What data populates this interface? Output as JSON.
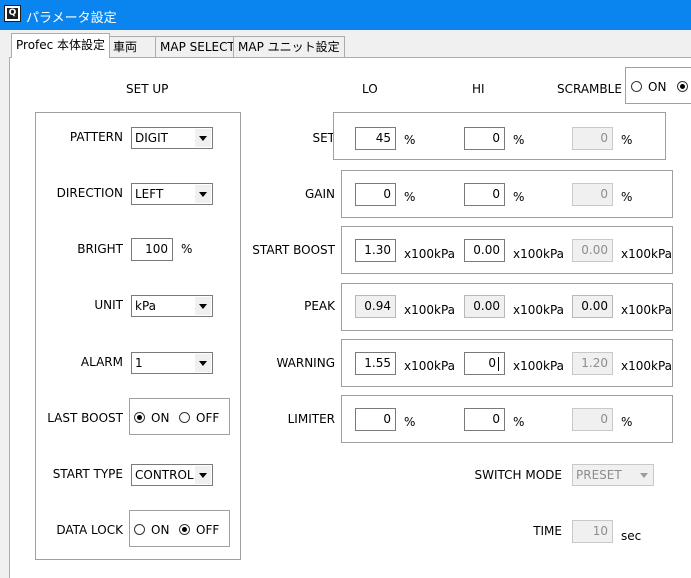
{
  "window": {
    "title": "パラメータ設定",
    "icon_text": "Q"
  },
  "tabs": [
    "Profec 本体設定",
    "車両",
    "MAP SELECT",
    "MAP ユニット設定"
  ],
  "setup": {
    "header": "SET UP",
    "pattern": {
      "label": "PATTERN",
      "value": "DIGIT"
    },
    "direction": {
      "label": "DIRECTION",
      "value": "LEFT"
    },
    "bright": {
      "label": "BRIGHT",
      "value": "100",
      "unit": "%"
    },
    "unit": {
      "label": "UNIT",
      "value": "kPa"
    },
    "alarm": {
      "label": "ALARM",
      "value": "1"
    },
    "last_boost": {
      "label": "LAST BOOST",
      "on": "ON",
      "off": "OFF",
      "selected": "ON"
    },
    "start_type": {
      "label": "START TYPE",
      "value": "CONTROL"
    },
    "data_lock": {
      "label": "DATA LOCK",
      "on": "ON",
      "off": "OFF",
      "selected": "OFF"
    }
  },
  "columns": {
    "lo": "LO",
    "hi": "HI",
    "scramble": "SCRAMBLE"
  },
  "scramble": {
    "on": "ON"
  },
  "rows": [
    {
      "label": "SET",
      "lo": "45",
      "hi": "0",
      "sc": "0",
      "unit": "%"
    },
    {
      "label": "GAIN",
      "lo": "0",
      "hi": "0",
      "sc": "0",
      "unit": "%"
    },
    {
      "label": "START BOOST",
      "lo": "1.30",
      "hi": "0.00",
      "sc": "0.00",
      "unit": "x100kPa"
    },
    {
      "label": "PEAK",
      "lo": "0.94",
      "hi": "0.00",
      "sc": "0.00",
      "unit": "x100kPa"
    },
    {
      "label": "WARNING",
      "lo": "1.55",
      "hi": "0",
      "sc": "1.20",
      "unit": "x100kPa"
    },
    {
      "label": "LIMITER",
      "lo": "0",
      "hi": "0",
      "sc": "0",
      "unit": "%"
    }
  ],
  "switch_mode": {
    "label": "SWITCH MODE",
    "value": "PRESET"
  },
  "time": {
    "label": "TIME",
    "value": "10",
    "unit": "sec"
  }
}
